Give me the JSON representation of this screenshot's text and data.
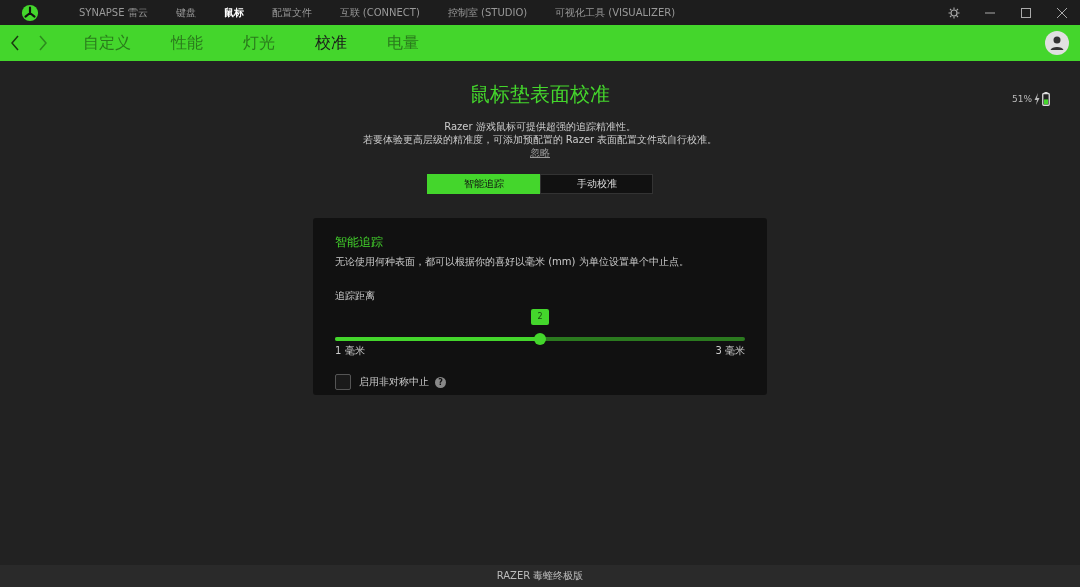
{
  "top_menu": [
    {
      "label": "SYNAPSE 雷云",
      "selected": false
    },
    {
      "label": "键盘",
      "selected": false
    },
    {
      "label": "鼠标",
      "selected": true
    },
    {
      "label": "配置文件",
      "selected": false
    },
    {
      "label": "互联 (CONNECT)",
      "selected": false
    },
    {
      "label": "控制室 (STUDIO)",
      "selected": false
    },
    {
      "label": "可视化工具 (VISUALIZER)",
      "selected": false
    }
  ],
  "tabs": [
    {
      "label": "自定义",
      "selected": false
    },
    {
      "label": "性能",
      "selected": false
    },
    {
      "label": "灯光",
      "selected": false
    },
    {
      "label": "校准",
      "selected": true
    },
    {
      "label": "电量",
      "selected": false
    }
  ],
  "battery": {
    "reading": "51%"
  },
  "title": "鼠标垫表面校准",
  "intro": [
    "Razer 游戏鼠标可提供超强的追踪精准性。",
    "若要体验更高层级的精准度，可添加预配置的 Razer 表面配置文件或自行校准。"
  ],
  "ignore_link": "忽略",
  "mode_switch": [
    {
      "label": "智能追踪",
      "selected": true
    },
    {
      "label": "手动校准",
      "selected": false
    }
  ],
  "panel": {
    "heading": "智能追踪",
    "description": "无论使用何种表面，都可以根据你的喜好以毫米 (mm) 为单位设置单个中止点。",
    "slider": {
      "label": "追踪距离",
      "value": "2",
      "level": 0.5,
      "min_label": "1 毫米",
      "max_label": "3 毫米"
    },
    "checkbox": {
      "label": "启用非对称中止",
      "checked": false,
      "help": "?"
    }
  },
  "footer": "RAZER 毒蝰终极版"
}
